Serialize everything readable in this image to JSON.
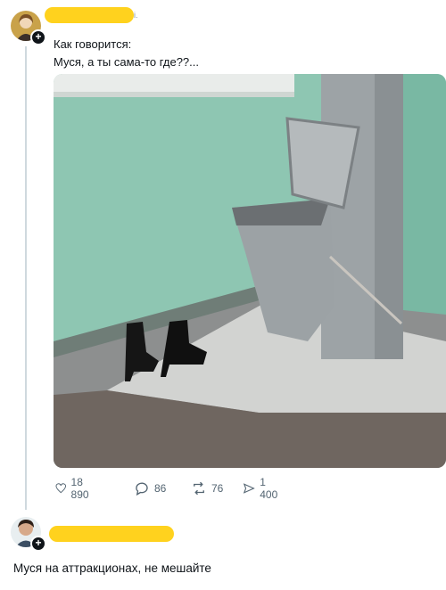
{
  "post": {
    "line1": "Как говорится:",
    "line2": "Муся, а ты сама-то где??..."
  },
  "stats": {
    "likes": "18 890",
    "replies": "86",
    "reposts": "76",
    "views": "1 400"
  },
  "reply": {
    "text": "Муся на аттракционах, не мешайте"
  },
  "icons": [
    "heart-icon",
    "reply-icon",
    "repost-icon",
    "views-icon",
    "plus-icon"
  ],
  "colors": {
    "redaction": "#ffd21e",
    "wall": "#8fc7b4",
    "chute": "#9aa0a4",
    "muted": "#536471"
  }
}
